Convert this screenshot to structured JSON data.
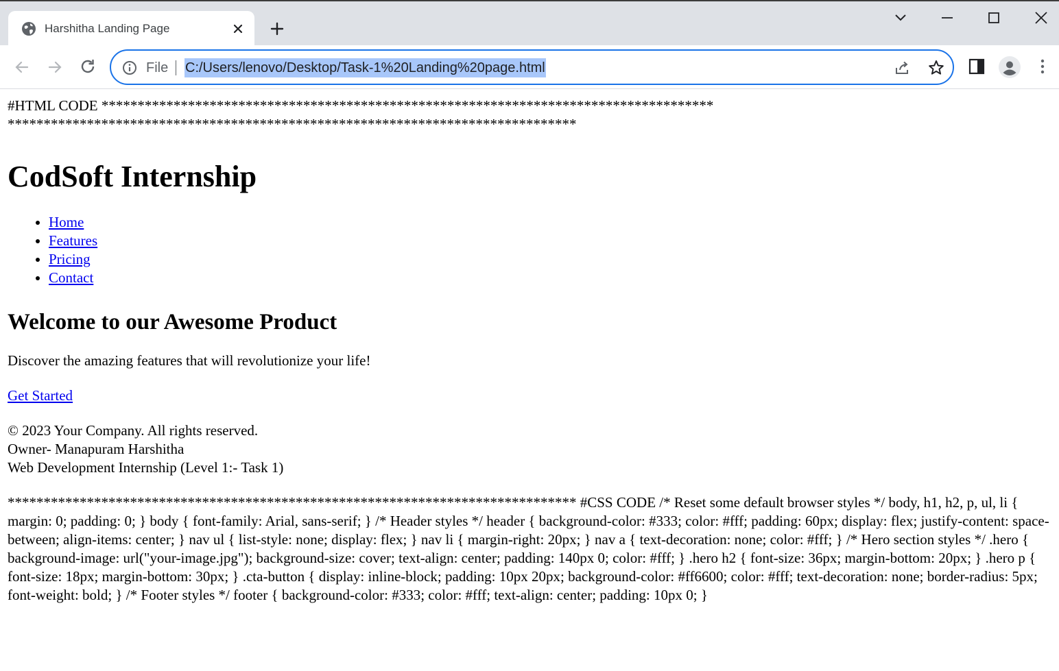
{
  "browser": {
    "tab_title": "Harshitha Landing Page",
    "scheme_label": "File",
    "url": "C:/Users/lenovo/Desktop/Task-1%20Landing%20page.html",
    "icons": {
      "favicon": "globe-icon",
      "tab_close": "close-icon",
      "new_tab": "plus-icon",
      "tab_search": "chevron-down-icon",
      "minimize": "minimize-icon",
      "maximize": "maximize-icon",
      "close_window": "close-icon",
      "back": "back-arrow-icon",
      "forward": "forward-arrow-icon",
      "reload": "reload-icon",
      "site_info": "info-icon",
      "share": "share-icon",
      "bookmark": "star-icon",
      "side_panel": "side-panel-icon",
      "profile": "profile-icon",
      "menu": "kebab-menu-icon"
    },
    "colors": {
      "focus_ring": "#1a73e8",
      "url_highlight": "#a8c7fa",
      "tabstrip_bg": "#dee1e6"
    }
  },
  "page": {
    "html_header_line1": "#HTML CODE *************************************************************************************",
    "html_header_line2": "*******************************************************************************",
    "title": "CodSoft Internship",
    "nav": [
      "Home",
      "Features",
      "Pricing",
      "Contact"
    ],
    "hero_heading": "Welcome to our Awesome Product",
    "hero_text": "Discover the amazing features that will revolutionize your life!",
    "cta": "Get Started",
    "footer": {
      "copyright": "© 2023 Your Company. All rights reserved.",
      "owner": "Owner- Manapuram Harshitha",
      "program": "Web Development Internship (Level 1:- Task 1)"
    },
    "css_dump": "******************************************************************************* #CSS CODE /* Reset some default browser styles */ body, h1, h2, p, ul, li { margin: 0; padding: 0; } body { font-family: Arial, sans-serif; } /* Header styles */ header { background-color: #333; color: #fff; padding: 60px; display: flex; justify-content: space-between; align-items: center; } nav ul { list-style: none; display: flex; } nav li { margin-right: 20px; } nav a { text-decoration: none; color: #fff; } /* Hero section styles */ .hero { background-image: url(\"your-image.jpg\"); background-size: cover; text-align: center; padding: 140px 0; color: #fff; } .hero h2 { font-size: 36px; margin-bottom: 20px; } .hero p { font-size: 18px; margin-bottom: 30px; } .cta-button { display: inline-block; padding: 10px 20px; background-color: #ff6600; color: #fff; text-decoration: none; border-radius: 5px; font-weight: bold; } /* Footer styles */ footer { background-color: #333; color: #fff; text-align: center; padding: 10px 0; }"
  }
}
